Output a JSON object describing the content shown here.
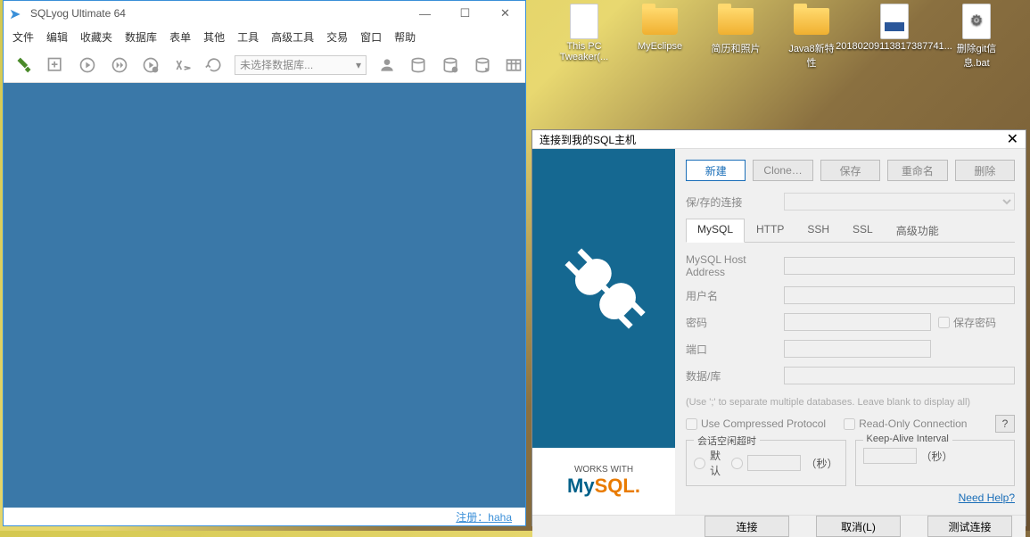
{
  "desktop": {
    "icons": [
      {
        "label": "This PC Tweaker(...",
        "type": "file"
      },
      {
        "label": "MyEclipse",
        "type": "folder"
      },
      {
        "label": "简历和照片",
        "type": "folder"
      },
      {
        "label": "Java8新特性",
        "type": "folder"
      },
      {
        "label": "20180209113817387741...",
        "type": "file-blue"
      },
      {
        "label": "删除git信息.bat",
        "type": "file-gear"
      }
    ]
  },
  "main": {
    "title": "SQLyog Ultimate 64",
    "menu": [
      "文件",
      "编辑",
      "收藏夹",
      "数据库",
      "表单",
      "其他",
      "工具",
      "高级工具",
      "交易",
      "窗口",
      "帮助"
    ],
    "db_placeholder": "未选择数据库...",
    "status_label": "注册：",
    "status_value": "haha"
  },
  "dialog": {
    "title": "连接到我的SQL主机",
    "buttons": {
      "new": "新建",
      "clone": "Clone…",
      "save": "保存",
      "rename": "重命名",
      "delete": "删除"
    },
    "saved_label": "保/存的连接",
    "tabs": [
      "MySQL",
      "HTTP",
      "SSH",
      "SSL",
      "高级功能"
    ],
    "fields": {
      "host": "MySQL Host Address",
      "user": "用户名",
      "pass": "密码",
      "savepw": "保存密码",
      "port": "端口",
      "db": "数据/库"
    },
    "note": "(Use ';' to separate multiple databases. Leave blank to display all)",
    "compressed": "Use Compressed Protocol",
    "readonly": "Read-Only Connection",
    "idle": {
      "title": "会话空闲超时",
      "default": "默认",
      "unit": "（秒）"
    },
    "keepalive": {
      "title": "Keep-Alive Interval",
      "unit": "（秒）"
    },
    "help": "Need Help?",
    "mysql_works": "WORKS WITH",
    "footer": {
      "connect": "连接",
      "cancel": "取消(L)",
      "test": "测试连接"
    }
  }
}
